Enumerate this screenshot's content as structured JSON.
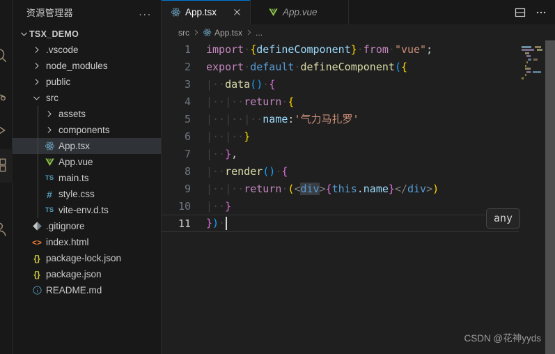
{
  "activity_bar": {
    "items": [
      {
        "name": "explorer-icon"
      },
      {
        "name": "search-icon"
      },
      {
        "name": "source-control-icon"
      },
      {
        "name": "run-debug-icon"
      },
      {
        "name": "extensions-icon"
      },
      {
        "name": "accounts-icon"
      }
    ]
  },
  "sidebar": {
    "title": "资源管理器",
    "more_actions": "...",
    "root": {
      "label": "TSX_DEMO",
      "expanded": true
    },
    "items": [
      {
        "label": ".vscode",
        "type": "folder",
        "expanded": false,
        "indent": 1,
        "icon": "chevron-right-icon"
      },
      {
        "label": "node_modules",
        "type": "folder",
        "expanded": false,
        "indent": 1,
        "icon": "chevron-right-icon"
      },
      {
        "label": "public",
        "type": "folder",
        "expanded": false,
        "indent": 1,
        "icon": "chevron-right-icon"
      },
      {
        "label": "src",
        "type": "folder",
        "expanded": true,
        "indent": 1,
        "icon": "chevron-down-icon"
      },
      {
        "label": "assets",
        "type": "folder",
        "expanded": false,
        "indent": 2,
        "icon": "chevron-right-icon"
      },
      {
        "label": "components",
        "type": "folder",
        "expanded": false,
        "indent": 2,
        "icon": "chevron-right-icon"
      },
      {
        "label": "App.tsx",
        "type": "file",
        "indent": 2,
        "icon": "react-icon",
        "selected": true
      },
      {
        "label": "App.vue",
        "type": "file",
        "indent": 2,
        "icon": "vue-icon"
      },
      {
        "label": "main.ts",
        "type": "file",
        "indent": 2,
        "icon": "typescript-icon"
      },
      {
        "label": "style.css",
        "type": "file",
        "indent": 2,
        "icon": "css-icon"
      },
      {
        "label": "vite-env.d.ts",
        "type": "file",
        "indent": 2,
        "icon": "typescript-icon"
      },
      {
        "label": ".gitignore",
        "type": "file",
        "indent": 1,
        "icon": "git-icon"
      },
      {
        "label": "index.html",
        "type": "file",
        "indent": 1,
        "icon": "html-icon"
      },
      {
        "label": "package-lock.json",
        "type": "file",
        "indent": 1,
        "icon": "json-icon"
      },
      {
        "label": "package.json",
        "type": "file",
        "indent": 1,
        "icon": "json-icon"
      },
      {
        "label": "README.md",
        "type": "file",
        "indent": 1,
        "icon": "markdown-icon"
      }
    ]
  },
  "editor": {
    "tabs": [
      {
        "label": "App.tsx",
        "icon": "react-icon",
        "active": true,
        "preview": false,
        "closable": true
      },
      {
        "label": "App.vue",
        "icon": "vue-icon",
        "active": false,
        "preview": true,
        "closable": false
      }
    ],
    "actions": [
      {
        "name": "split-editor-right-icon"
      },
      {
        "name": "more-actions-icon"
      }
    ],
    "breadcrumbs": [
      {
        "label": "src",
        "icon": null
      },
      {
        "label": "App.tsx",
        "icon": "react-icon"
      },
      {
        "label": "...",
        "icon": null
      }
    ],
    "hover_tooltip": "any",
    "cursor_line": 11,
    "line_numbers": [
      1,
      2,
      3,
      4,
      5,
      6,
      7,
      8,
      9,
      10,
      11
    ],
    "code_text": [
      "import {defineComponent} from \"vue\";",
      "export default defineComponent({",
      "  data() {",
      "    return {",
      "      name:'气力马扎罗'",
      "    }",
      "  },",
      "  render() {",
      "    return (<div>{this.name}</div>)",
      "  }",
      "})"
    ],
    "minimap": {
      "rows": [
        [
          {
            "w": 14,
            "c": "#6d8ea0"
          },
          {
            "w": 3,
            "c": "#1f1f1f"
          },
          {
            "w": 9,
            "c": "#8a7a55"
          },
          {
            "w": 2,
            "c": "#1f1f1f"
          },
          {
            "w": 5,
            "c": "#6b6055"
          }
        ],
        [
          {
            "w": 18,
            "c": "#7a6a8a"
          },
          {
            "w": 2,
            "c": "#1f1f1f"
          },
          {
            "w": 8,
            "c": "#8a8560"
          }
        ],
        [
          {
            "w": 4,
            "c": "#1f1f1f"
          },
          {
            "w": 6,
            "c": "#8a8560"
          }
        ],
        [
          {
            "w": 6,
            "c": "#1f1f1f"
          },
          {
            "w": 6,
            "c": "#7a6a8a"
          }
        ],
        [
          {
            "w": 8,
            "c": "#1f1f1f"
          },
          {
            "w": 5,
            "c": "#5a7a90"
          },
          {
            "w": 1,
            "c": "#1f1f1f"
          },
          {
            "w": 6,
            "c": "#7d6350"
          }
        ],
        [
          {
            "w": 6,
            "c": "#1f1f1f"
          },
          {
            "w": 2,
            "c": "#8a7a40"
          }
        ],
        [
          {
            "w": 4,
            "c": "#1f1f1f"
          },
          {
            "w": 2,
            "c": "#8a7a40"
          }
        ],
        [
          {
            "w": 4,
            "c": "#1f1f1f"
          },
          {
            "w": 8,
            "c": "#8a8560"
          }
        ],
        [
          {
            "w": 6,
            "c": "#1f1f1f"
          },
          {
            "w": 6,
            "c": "#7a6a8a"
          },
          {
            "w": 1,
            "c": "#1f1f1f"
          },
          {
            "w": 12,
            "c": "#5a7a90"
          }
        ],
        [
          {
            "w": 4,
            "c": "#1f1f1f"
          },
          {
            "w": 2,
            "c": "#8a7a40"
          }
        ],
        [
          {
            "w": 3,
            "c": "#8a7a40"
          }
        ]
      ]
    }
  },
  "watermark": "CSDN @花神yyds",
  "colors": {
    "editor_bg": "#1f1f1f",
    "sidebar_bg": "#181818",
    "selection_bg": "#2f3337",
    "accent": "#0078d4",
    "keyword": "#C586C0",
    "string": "#CE9178",
    "variable": "#9CDCFE",
    "function": "#DCDCAA",
    "brace_yellow": "#FFD700",
    "brace_purple": "#DA70D6",
    "paren_blue": "#179FFF"
  }
}
